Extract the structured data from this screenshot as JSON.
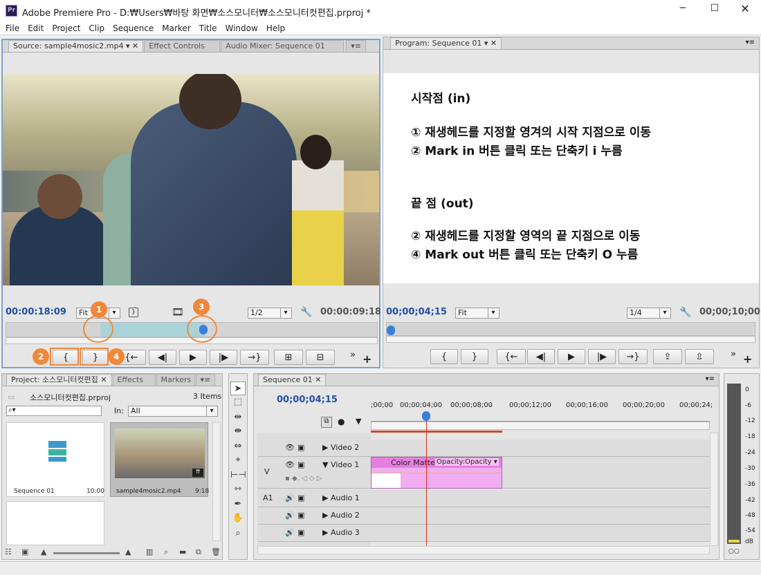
{
  "window": {
    "title": "Adobe Premiere Pro - D:₩Users₩바탕 화면₩소스모니터₩소스모니터컷편집.prproj *",
    "app_icon": "Pr"
  },
  "menu": [
    "File",
    "Edit",
    "Project",
    "Clip",
    "Sequence",
    "Marker",
    "Title",
    "Window",
    "Help"
  ],
  "source_panel": {
    "tabs": [
      "Source: sample4mosic2.mp4",
      "Effect Controls",
      "Audio Mixer: Sequence 01"
    ],
    "timecode": "00:00:18:09",
    "fit": "Fit",
    "resolution": "1/2",
    "duration": "00:00:09:18"
  },
  "program_panel": {
    "tab": "Program: Sequence 01",
    "timecode": "00;00;04;15",
    "fit": "Fit",
    "resolution": "1/4",
    "duration": "00;00;10;00"
  },
  "overlay_text": {
    "in_heading": "시작점  (in)",
    "in_step1": "① 재생헤드를 지정할 영겨의 시작 지점으로 이동",
    "in_step2": "② Mark in 버튼 클릭 또는 단축키 i 누름",
    "out_heading": "끝 점 (out)",
    "out_step1": "② 재생헤드를 지정할 영역의 끝 지점으로 이동",
    "out_step2": "④ Mark out 버튼 클릭 또는 단축키 O 누름"
  },
  "callouts": [
    "1",
    "2",
    "3",
    "4"
  ],
  "project_panel": {
    "tabs": [
      "Project: 소스모니터컷편집",
      "Effects",
      "Markers"
    ],
    "project_file": "소스모니터컷편집.prproj",
    "item_count": "3 Items",
    "in_label": "In:",
    "in_value": "All",
    "items": [
      {
        "name": "Sequence 01",
        "duration": "10:00"
      },
      {
        "name": "sample4mosic2.mp4",
        "duration": "9:18"
      }
    ]
  },
  "timeline": {
    "tab": "Sequence 01",
    "timecode": "00;00;04;15",
    "ruler": [
      ";00;00",
      "00;00;04;00",
      "00;00;08;00",
      "00;00;12;00",
      "00;00;16;00",
      "00;00;20;00",
      "00;00;24;"
    ],
    "video_label": "V",
    "audio_label": "A1",
    "tracks": [
      "Video 2",
      "Video 1",
      "Audio 1",
      "Audio 2",
      "Audio 3"
    ],
    "clip": {
      "name": "Color Matte",
      "effect": "Opacity:Opacity"
    }
  },
  "meter": {
    "scale": [
      "0",
      "-6",
      "-12",
      "-18",
      "-24",
      "-30",
      "-36",
      "-42",
      "-48",
      "-54",
      "dB"
    ]
  },
  "colors": {
    "timecode_blue": "#2150a8",
    "callout_orange": "#f0883a",
    "clip_pink": "#e67fe0",
    "playhead": "#e03020"
  }
}
